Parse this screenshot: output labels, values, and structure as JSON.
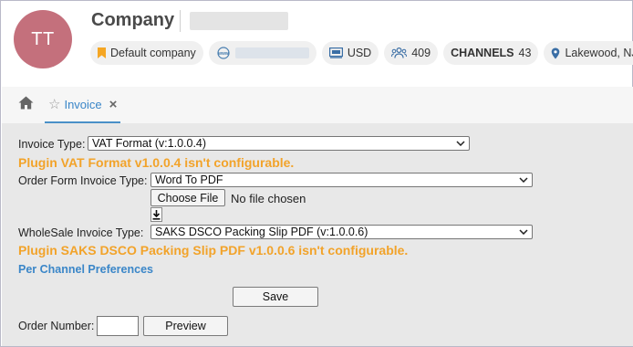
{
  "header": {
    "avatar_initials": "TT",
    "company_label": "Company",
    "chips": {
      "company_type": "Default company",
      "currency": "USD",
      "users_count": "409",
      "channels_label": "CHANNELS",
      "channels_count": "43",
      "location": "Lakewood, NJ"
    },
    "colors": {
      "avatar_bg": "#c4707c",
      "bookmark_icon": "#f5a623",
      "accent_blue": "#3a86c8"
    }
  },
  "tabs": {
    "home_icon": "home-icon",
    "active_tab": {
      "label": "Invoice",
      "icon": "star-outline-icon",
      "close": "×"
    }
  },
  "form": {
    "invoice_type": {
      "label": "Invoice Type:",
      "value": "VAT Format (v:1.0.0.4)"
    },
    "invoice_warning": "Plugin VAT Format v1.0.0.4 isn't configurable.",
    "order_form_type": {
      "label": "Order Form Invoice Type:",
      "value": "Word To PDF"
    },
    "file": {
      "button": "Choose File",
      "status": "No file chosen"
    },
    "wholesale_type": {
      "label": "WholeSale Invoice Type:",
      "value": "SAKS DSCO Packing Slip PDF (v:1.0.0.6)"
    },
    "wholesale_warning": "Plugin SAKS DSCO Packing Slip PDF v1.0.0.6 isn't configurable.",
    "per_channel_link": "Per Channel Preferences",
    "save_label": "Save",
    "order_number_label": "Order Number:",
    "order_number_value": "",
    "preview_label": "Preview",
    "warning_color": "#f2a32a"
  }
}
